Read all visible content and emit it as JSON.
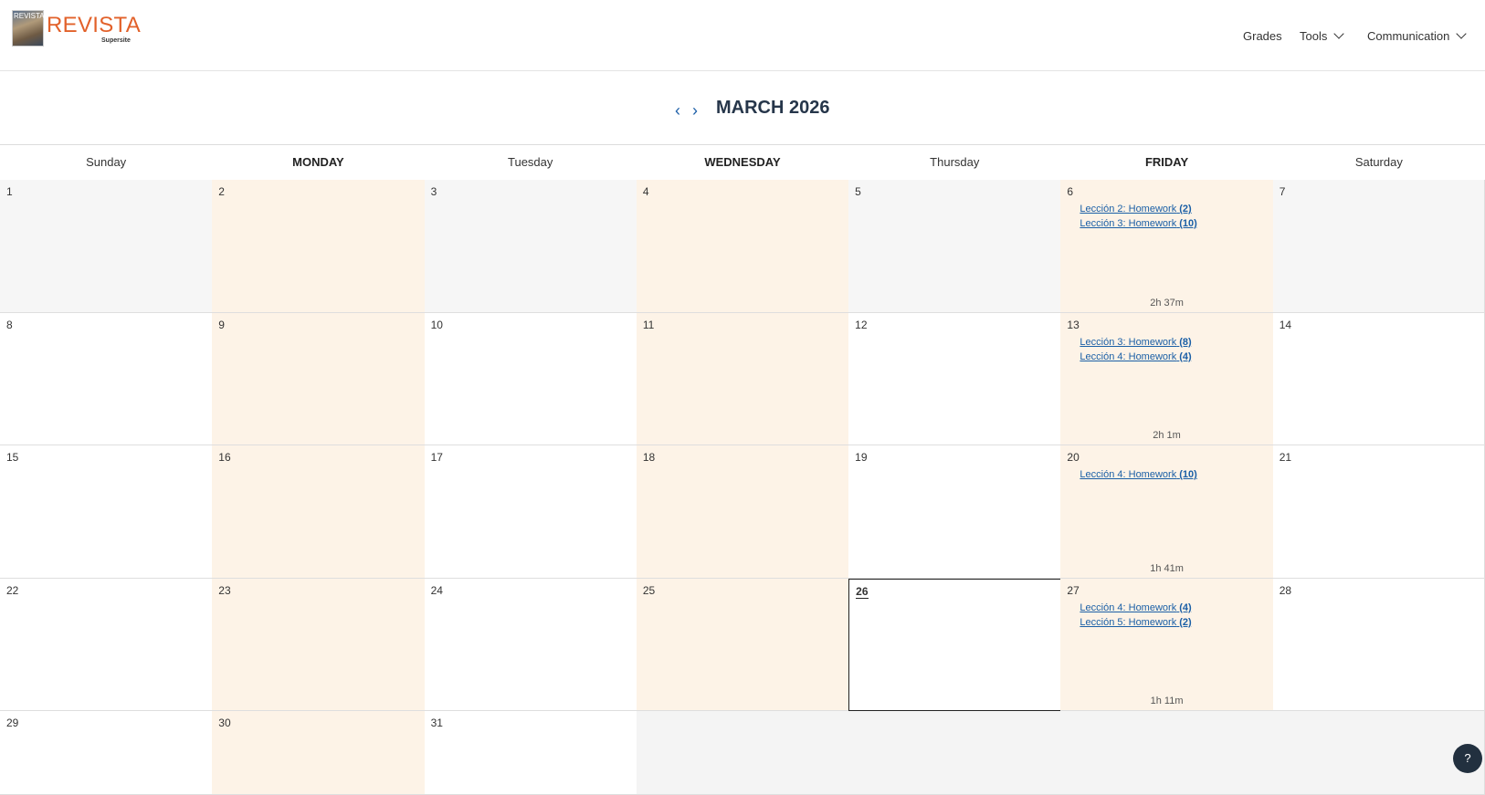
{
  "header": {
    "logo_small": "REVISTA",
    "logo_text": "REVISTA",
    "logo_sub": "Supersite",
    "nav": [
      {
        "label": "Grades",
        "has_dropdown": false
      },
      {
        "label": "Tools",
        "has_dropdown": true
      },
      {
        "label": "Communication",
        "has_dropdown": true
      }
    ]
  },
  "calendar": {
    "month_title": "MARCH 2026",
    "weekdays": [
      "Sunday",
      "MONDAY",
      "Tuesday",
      "WEDNESDAY",
      "Thursday",
      "FRIDAY",
      "Saturday"
    ],
    "weeks": [
      [
        {
          "day": "1"
        },
        {
          "day": "2"
        },
        {
          "day": "3"
        },
        {
          "day": "4"
        },
        {
          "day": "5"
        },
        {
          "day": "6",
          "events": [
            {
              "label": "Lección 2: Homework",
              "count": "(2)"
            },
            {
              "label": "Lección 3: Homework",
              "count": "(10)"
            }
          ],
          "duration": "2h 37m"
        },
        {
          "day": "7"
        }
      ],
      [
        {
          "day": "8"
        },
        {
          "day": "9"
        },
        {
          "day": "10"
        },
        {
          "day": "11"
        },
        {
          "day": "12"
        },
        {
          "day": "13",
          "events": [
            {
              "label": "Lección 3: Homework",
              "count": "(8)"
            },
            {
              "label": "Lección 4: Homework",
              "count": "(4)"
            }
          ],
          "duration": "2h 1m"
        },
        {
          "day": "14"
        }
      ],
      [
        {
          "day": "15"
        },
        {
          "day": "16"
        },
        {
          "day": "17"
        },
        {
          "day": "18"
        },
        {
          "day": "19"
        },
        {
          "day": "20",
          "events": [
            {
              "label": "Lección 4: Homework",
              "count": "(10)"
            }
          ],
          "duration": "1h 41m"
        },
        {
          "day": "21"
        }
      ],
      [
        {
          "day": "22"
        },
        {
          "day": "23"
        },
        {
          "day": "24"
        },
        {
          "day": "25"
        },
        {
          "day": "26",
          "today": true
        },
        {
          "day": "27",
          "events": [
            {
              "label": "Lección 4: Homework",
              "count": "(4)"
            },
            {
              "label": "Lección 5: Homework",
              "count": "(2)"
            }
          ],
          "duration": "1h 11m"
        },
        {
          "day": "28"
        }
      ],
      [
        {
          "day": "29"
        },
        {
          "day": "30"
        },
        {
          "day": "31"
        },
        {
          "day": ""
        },
        {
          "day": ""
        },
        {
          "day": ""
        },
        {
          "day": ""
        }
      ]
    ]
  },
  "help": {
    "icon": "help-chat-icon",
    "glyph": "?"
  },
  "colors": {
    "accent": "#e2612a",
    "link": "#1a5fa6",
    "peach": "#fdf3e7"
  }
}
